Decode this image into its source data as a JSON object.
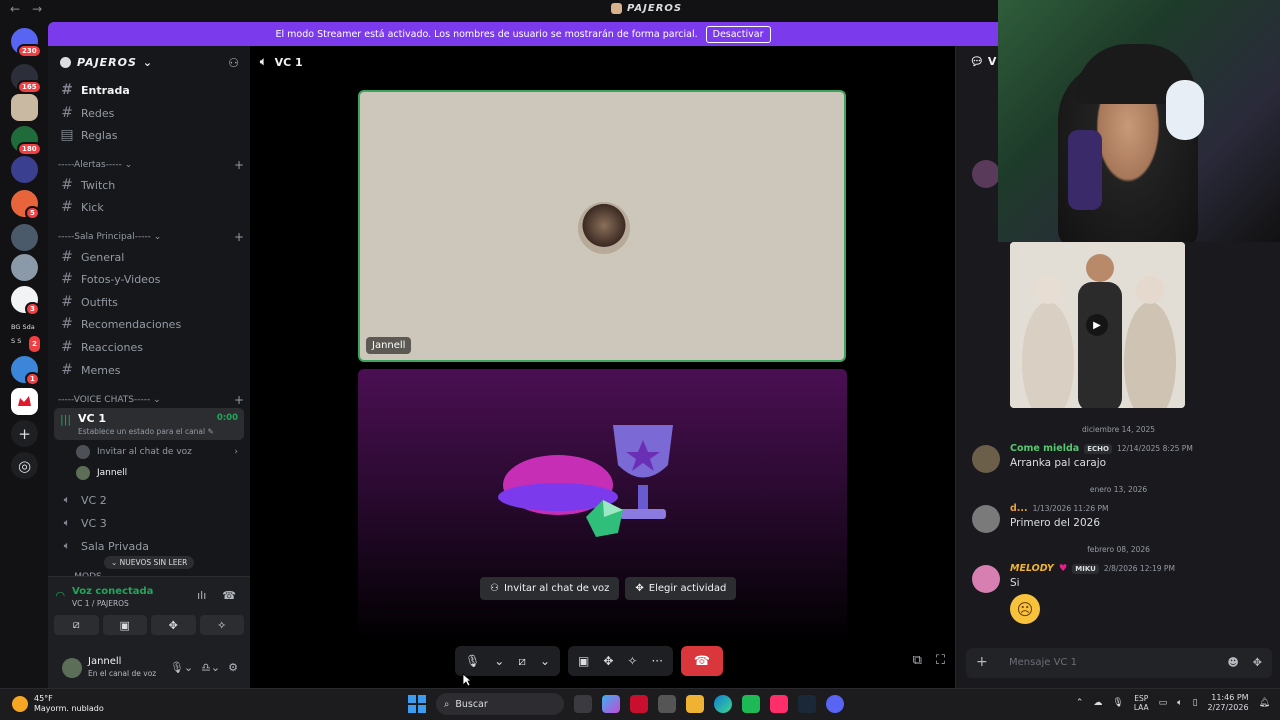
{
  "titlebar": {
    "title": "PAJEROS"
  },
  "banner": {
    "text": "El modo Streamer está activado. Los nombres de usuario se mostrarán de forma parcial.",
    "button": "Desactivar"
  },
  "rail": {
    "badges": [
      "230",
      "165",
      "180",
      "5",
      "3",
      "2",
      "1"
    ],
    "label_bg": "BG",
    "label_sda": "Sda",
    "label_s": "S",
    "label_s2": "S"
  },
  "guild": {
    "name": "PAJEROS"
  },
  "channels_top": [
    {
      "label": "Entrada",
      "icon": "#"
    },
    {
      "label": "Redes",
      "icon": "#"
    },
    {
      "label": "Reglas",
      "icon": "▤"
    }
  ],
  "cat_alertas": "-----Alertas-----",
  "channels_alertas": [
    {
      "label": "Twitch",
      "icon": "#"
    },
    {
      "label": "Kick",
      "icon": "#"
    }
  ],
  "cat_sala": "-----Sala Principal-----",
  "channels_sala": [
    {
      "label": "General",
      "icon": "#"
    },
    {
      "label": "Fotos-y-Videos",
      "icon": "#"
    },
    {
      "label": "Outfits",
      "icon": "#"
    },
    {
      "label": "Recomendaciones",
      "icon": "#"
    },
    {
      "label": "Reacciones",
      "icon": "#"
    },
    {
      "label": "Memes",
      "icon": "#"
    }
  ],
  "cat_voice": "-----VOICE CHATS-----",
  "vc_active": {
    "name": "VC 1",
    "timer": "0:00",
    "status": "Establece un estado para el canal ✎",
    "invite": "Invitar al chat de voz",
    "member": "Jannell"
  },
  "channels_voice": [
    {
      "label": "VC 2"
    },
    {
      "label": "VC 3"
    },
    {
      "label": "Sala Privada"
    }
  ],
  "cat_mods": "-----MODS-----",
  "unread_pill": "NUEVOS SIN LEER",
  "voice_panel": {
    "connected": "Voz conectada",
    "location": "VC 1 / PAJEROS"
  },
  "user": {
    "name": "Jannell",
    "status": "En el canal de voz"
  },
  "stage": {
    "channel": "VC 1",
    "tile_name": "Jannell",
    "invite_btn": "Invitar al chat de voz",
    "activity_btn": "Elegir actividad"
  },
  "chat": {
    "header": "V",
    "date1": "diciembre 14, 2025",
    "msg1": {
      "name": "Come mielda",
      "tag": "ECHO",
      "time": "12/14/2025 8:25 PM",
      "text": "Arranka pal carajo",
      "color": "#57c76f"
    },
    "date2": "enero 13, 2026",
    "msg2": {
      "name": "d...",
      "time": "1/13/2026 11:26 PM",
      "text": "Primero del 2026",
      "color": "#e8a03a"
    },
    "date3": "febrero 08, 2026",
    "msg3": {
      "name": "MELODY",
      "tag": "MIKU",
      "time": "2/8/2026 12:19 PM",
      "text": "Si",
      "color": "#f0b232"
    },
    "input_placeholder": "Mensaje VC 1"
  },
  "taskbar": {
    "temp": "45°F",
    "weather": "Mayorm. nublado",
    "search": "Buscar",
    "lang1": "ESP",
    "lang2": "LAA",
    "time": "11:46 PM",
    "date": "2/27/2026"
  },
  "colors": {
    "accent": "#7c3aed",
    "green": "#23a55a",
    "red": "#da373c"
  }
}
